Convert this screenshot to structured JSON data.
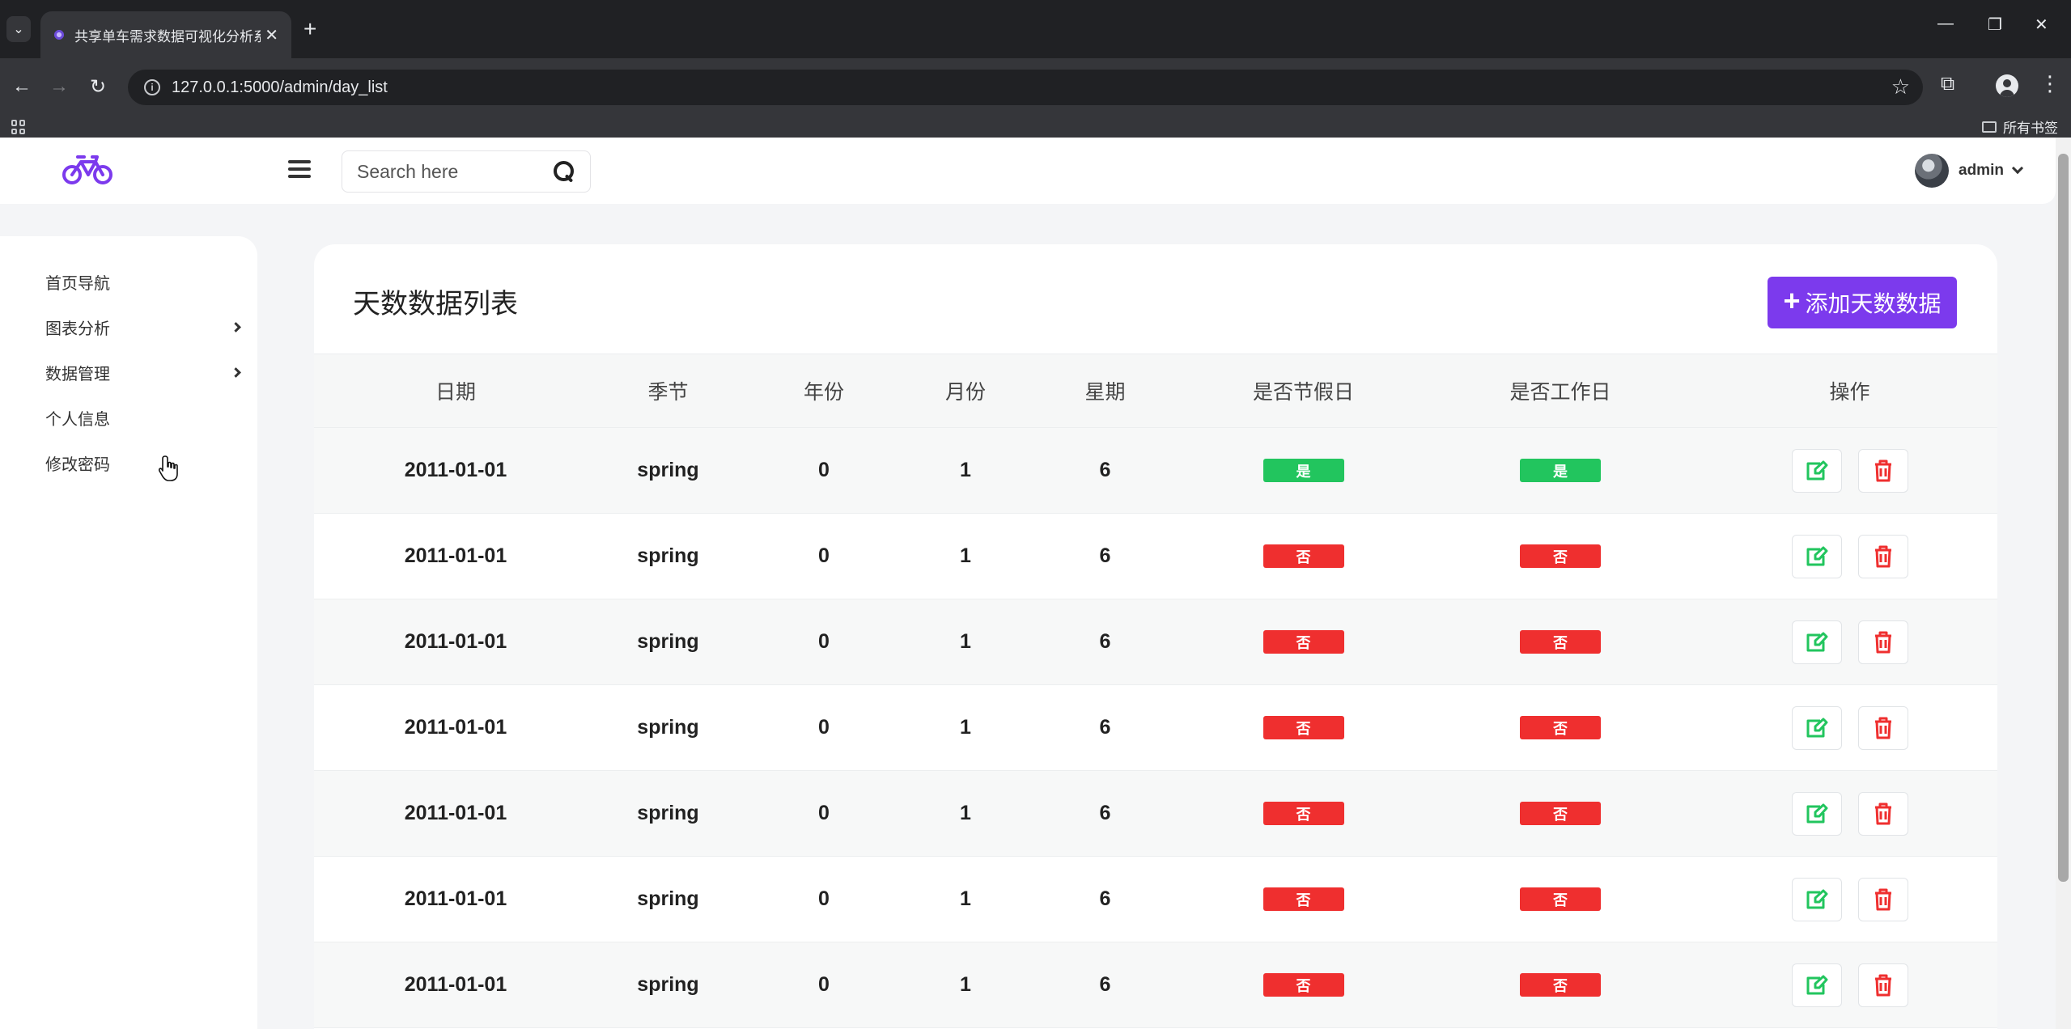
{
  "browser": {
    "tab_title": "共享单车需求数据可视化分析系统",
    "url": "127.0.0.1:5000/admin/day_list",
    "bookmarks_folder": "所有书签"
  },
  "header": {
    "search_placeholder": "Search here",
    "user_name": "admin"
  },
  "sidebar": {
    "items": [
      {
        "label": "首页导航",
        "has_submenu": false
      },
      {
        "label": "图表分析",
        "has_submenu": true
      },
      {
        "label": "数据管理",
        "has_submenu": true
      },
      {
        "label": "个人信息",
        "has_submenu": false
      },
      {
        "label": "修改密码",
        "has_submenu": false
      }
    ]
  },
  "main": {
    "title": "天数数据列表",
    "add_button_label": "添加天数数据",
    "columns": [
      "日期",
      "季节",
      "年份",
      "月份",
      "星期",
      "是否节假日",
      "是否工作日",
      "操作"
    ],
    "rows": [
      {
        "date": "2011-01-01",
        "season": "spring",
        "year": "0",
        "month": "1",
        "weekday": "6",
        "holiday": "是",
        "workingday": "是"
      },
      {
        "date": "2011-01-01",
        "season": "spring",
        "year": "0",
        "month": "1",
        "weekday": "6",
        "holiday": "否",
        "workingday": "否"
      },
      {
        "date": "2011-01-01",
        "season": "spring",
        "year": "0",
        "month": "1",
        "weekday": "6",
        "holiday": "否",
        "workingday": "否"
      },
      {
        "date": "2011-01-01",
        "season": "spring",
        "year": "0",
        "month": "1",
        "weekday": "6",
        "holiday": "否",
        "workingday": "否"
      },
      {
        "date": "2011-01-01",
        "season": "spring",
        "year": "0",
        "month": "1",
        "weekday": "6",
        "holiday": "否",
        "workingday": "否"
      },
      {
        "date": "2011-01-01",
        "season": "spring",
        "year": "0",
        "month": "1",
        "weekday": "6",
        "holiday": "否",
        "workingday": "否"
      },
      {
        "date": "2011-01-01",
        "season": "spring",
        "year": "0",
        "month": "1",
        "weekday": "6",
        "holiday": "否",
        "workingday": "否"
      }
    ]
  },
  "colors": {
    "accent": "#7c3aed",
    "yes_badge": "#22c55e",
    "no_badge": "#ef2f2f",
    "edit_icon": "#22c55e",
    "delete_icon": "#ef2f2f"
  },
  "icons": {
    "logo": "bicycle-icon",
    "menu": "hamburger-icon",
    "search": "search-icon",
    "edit": "edit-icon",
    "delete": "trash-icon"
  }
}
